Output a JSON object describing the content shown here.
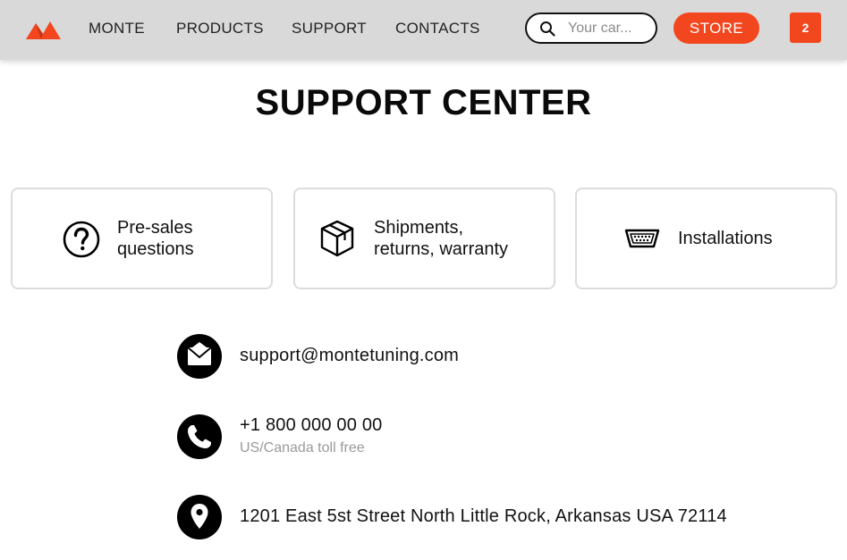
{
  "brand": {
    "name": "MONTE",
    "accent_color": "#f2461e"
  },
  "nav": {
    "items": [
      {
        "label": "MONTE"
      },
      {
        "label": "PRODUCTS"
      },
      {
        "label": "SUPPORT"
      },
      {
        "label": "CONTACTS"
      }
    ]
  },
  "search": {
    "placeholder": "Your car...",
    "icon": "search-icon"
  },
  "store_button": {
    "label": "STORE"
  },
  "cart": {
    "count": "2"
  },
  "page": {
    "title": "SUPPORT CENTER"
  },
  "cards": [
    {
      "label_line1": "Pre-sales",
      "label_line2": "questions",
      "icon": "question-circle-icon"
    },
    {
      "label_line1": "Shipments,",
      "label_line2": "returns, warranty",
      "icon": "box-icon"
    },
    {
      "label_line1": "Installations",
      "icon": "connector-icon"
    }
  ],
  "contacts": {
    "email": {
      "value": "support@montetuning.com",
      "icon": "envelope-icon"
    },
    "phone": {
      "value": "+1 800 000 00 00",
      "note": "US/Canada toll free",
      "icon": "phone-icon"
    },
    "address": {
      "value": "1201 East 5st Street North Little Rock, Arkansas USA 72114",
      "icon": "map-pin-icon"
    }
  }
}
